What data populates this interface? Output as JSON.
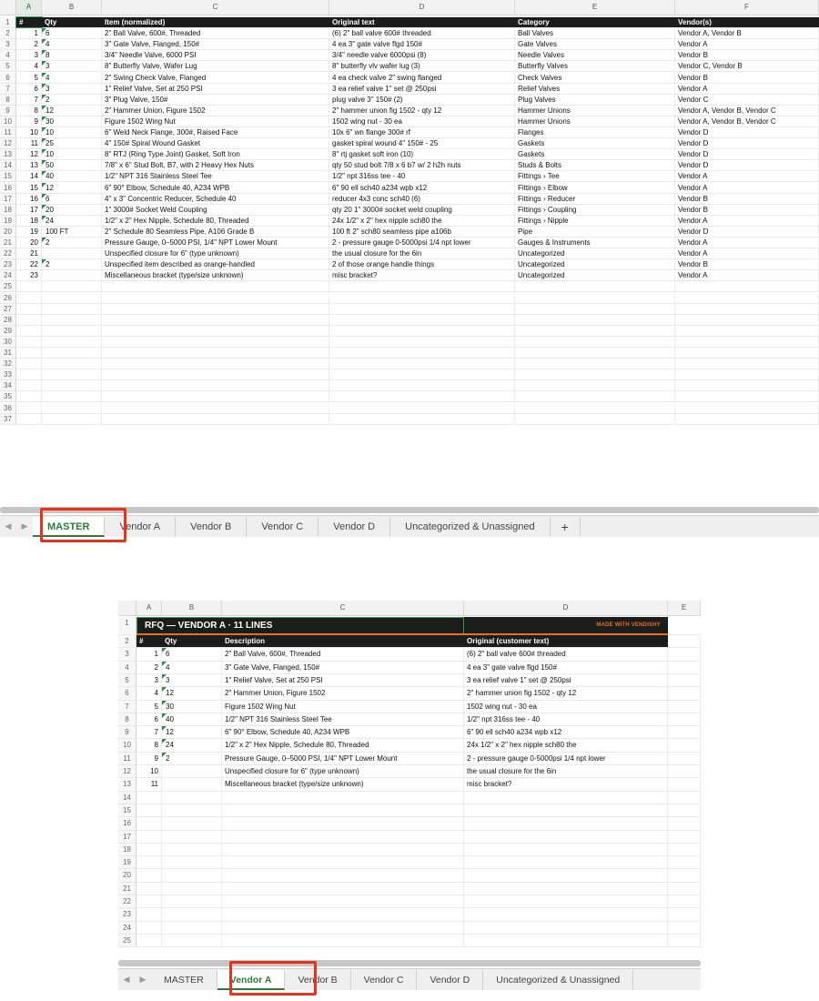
{
  "master": {
    "columns": [
      "A",
      "B",
      "C",
      "D",
      "E",
      "F"
    ],
    "headers": [
      "#",
      "Qty",
      "Item (normalized)",
      "Original text",
      "Category",
      "Vendor(s)"
    ],
    "rows": [
      [
        "1",
        "6",
        "2\" Ball Valve, 600#, Threaded",
        "(6) 2\" ball valve 600# threaded",
        "Ball Valves",
        "Vendor A, Vendor B"
      ],
      [
        "2",
        "4",
        "3\" Gate Valve, Flanged, 150#",
        "4 ea 3\" gate valve flgd 150#",
        "Gate Valves",
        "Vendor A"
      ],
      [
        "3",
        "8",
        "3/4\" Needle Valve, 6000 PSI",
        "3/4\" needle valve 6000psi (8)",
        "Needle Valves",
        "Vendor B"
      ],
      [
        "4",
        "3",
        "8\" Butterfly Valve, Wafer Lug",
        "8\" butterfly vlv wafer lug (3)",
        "Butterfly Valves",
        "Vendor C, Vendor B"
      ],
      [
        "5",
        "4",
        "2\" Swing Check Valve, Flanged",
        "4 ea check valve 2\" swing flanged",
        "Check Valves",
        "Vendor B"
      ],
      [
        "6",
        "3",
        "1\" Relief Valve, Set at 250 PSI",
        "3 ea relief valve 1\" set @ 250psi",
        "Relief Valves",
        "Vendor A"
      ],
      [
        "7",
        "2",
        "3\" Plug Valve, 150#",
        "plug valve 3\" 150# (2)",
        "Plug Valves",
        "Vendor C"
      ],
      [
        "8",
        "12",
        "2\" Hammer Union, Figure 1502",
        "2\" hammer union fig 1502 - qty 12",
        "Hammer Unions",
        "Vendor A, Vendor B, Vendor C"
      ],
      [
        "9",
        "30",
        "Figure 1502 Wing Nut",
        "1502 wing nut - 30 ea",
        "Hammer Unions",
        "Vendor A, Vendor B, Vendor C"
      ],
      [
        "10",
        "10",
        "6\" Weld Neck Flange, 300#, Raised Face",
        "10x 6\" wn flange 300# rf",
        "Flanges",
        "Vendor D"
      ],
      [
        "11",
        "25",
        "4\" 150# Spiral Wound Gasket",
        "gasket spiral wound 4\" 150# - 25",
        "Gaskets",
        "Vendor D"
      ],
      [
        "12",
        "10",
        "8\" RTJ (Ring Type Joint) Gasket, Soft Iron",
        "8\" rtj gasket soft iron (10)",
        "Gaskets",
        "Vendor D"
      ],
      [
        "13",
        "50",
        "7/8\" x 6\" Stud Bolt, B7, with 2 Heavy Hex Nuts",
        "qty 50 stud bolt 7/8 x 6 b7 w/ 2 h2h nuts",
        "Studs & Bolts",
        "Vendor D"
      ],
      [
        "14",
        "40",
        "1/2\" NPT 316 Stainless Steel Tee",
        "1/2\" npt 316ss tee - 40",
        "Fittings › Tee",
        "Vendor A"
      ],
      [
        "15",
        "12",
        "6\" 90° Elbow, Schedule 40, A234 WPB",
        "6\" 90 ell sch40 a234 wpb x12",
        "Fittings › Elbow",
        "Vendor A"
      ],
      [
        "16",
        "6",
        "4\" x 3\" Concentric Reducer, Schedule 40",
        "reducer 4x3 conc sch40 (6)",
        "Fittings › Reducer",
        "Vendor B"
      ],
      [
        "17",
        "20",
        "1\" 3000# Socket Weld Coupling",
        "qty 20 1\" 3000# socket weld coupling",
        "Fittings › Coupling",
        "Vendor B"
      ],
      [
        "18",
        "24",
        "1/2\" x 2\" Hex Nipple, Schedule 80, Threaded",
        "24x 1/2\" x 2\" hex nipple sch80 the",
        "Fittings › Nipple",
        "Vendor A"
      ],
      [
        "19",
        "100 FT",
        "2\" Schedule 80 Seamless Pipe, A106 Grade B",
        "100 ft 2\" sch80 seamless pipe a106b",
        "Pipe",
        "Vendor D"
      ],
      [
        "20",
        "2",
        "Pressure Gauge, 0–5000 PSI, 1/4\" NPT Lower Mount",
        "2 - pressure gauge 0-5000psi 1/4 npt lower",
        "Gauges & Instruments",
        "Vendor A"
      ],
      [
        "21",
        "",
        "Unspecified closure for 6\" (type unknown)",
        "the usual closure for the 6in",
        "Uncategorized",
        "Vendor A"
      ],
      [
        "22",
        "2",
        "Unspecified item described as orange-handled",
        "2 of those orange handle things",
        "Uncategorized",
        "Vendor B"
      ],
      [
        "23",
        "",
        "Miscellaneous bracket (type/size unknown)",
        "misc bracket?",
        "Uncategorized",
        "Vendor A"
      ]
    ],
    "row_numbers": [
      "1",
      "2",
      "3",
      "4",
      "5",
      "6",
      "7",
      "8",
      "9",
      "10",
      "11",
      "12",
      "13",
      "14",
      "15",
      "16",
      "17",
      "18",
      "19",
      "20",
      "21",
      "22",
      "23",
      "24",
      "25",
      "26",
      "27",
      "28",
      "29",
      "30",
      "31",
      "32",
      "33",
      "34",
      "35",
      "36",
      "37"
    ],
    "tabs": [
      "MASTER",
      "Vendor A",
      "Vendor B",
      "Vendor C",
      "Vendor D",
      "Uncategorized & Unassigned",
      "+"
    ],
    "active_tab": "MASTER"
  },
  "vendor_a": {
    "columns": [
      "A",
      "B",
      "C",
      "D",
      "E"
    ],
    "banner_title": "RFQ — VENDOR A  ·  11 LINES",
    "banner_made": "MADE WITH VENDISHY",
    "headers": [
      "#",
      "Qty",
      "Description",
      "Original (customer text)"
    ],
    "rows": [
      [
        "1",
        "6",
        "2\" Ball Valve, 600#, Threaded",
        "(6) 2\" ball valve 600# threaded"
      ],
      [
        "2",
        "4",
        "3\" Gate Valve, Flanged, 150#",
        "4 ea 3\" gate valve flgd 150#"
      ],
      [
        "3",
        "3",
        "1\" Relief Valve, Set at 250 PSI",
        "3 ea relief valve 1\" set @ 250psi"
      ],
      [
        "4",
        "12",
        "2\" Hammer Union, Figure 1502",
        "2\" hammer union fig 1502 - qty 12"
      ],
      [
        "5",
        "30",
        "Figure 1502 Wing Nut",
        "1502 wing nut - 30 ea"
      ],
      [
        "6",
        "40",
        "1/2\" NPT 316 Stainless Steel Tee",
        "1/2\" npt 316ss tee - 40"
      ],
      [
        "7",
        "12",
        "6\" 90° Elbow, Schedule 40, A234 WPB",
        "6\" 90 ell sch40 a234 wpb x12"
      ],
      [
        "8",
        "24",
        "1/2\" x 2\" Hex Nipple, Schedule 80, Threaded",
        "24x 1/2\" x 2\" hex nipple sch80 the"
      ],
      [
        "9",
        "2",
        "Pressure Gauge, 0–5000 PSI, 1/4\" NPT Lower Mount",
        "2 - pressure gauge 0-5000psi 1/4 npt lower"
      ],
      [
        "10",
        "",
        "Unspecified closure for 6\" (type unknown)",
        "the usual closure for the 6in"
      ],
      [
        "11",
        "",
        "Miscellaneous bracket (type/size unknown)",
        "misc bracket?"
      ]
    ],
    "row_numbers": [
      "1",
      "2",
      "3",
      "4",
      "5",
      "6",
      "7",
      "8",
      "9",
      "10",
      "11",
      "12",
      "13",
      "14",
      "15",
      "16",
      "17",
      "18",
      "19",
      "20",
      "21",
      "22",
      "23",
      "24",
      "25"
    ],
    "tabs": [
      "MASTER",
      "Vendor A",
      "Vendor B",
      "Vendor C",
      "Vendor D",
      "Uncategorized & Unassigned"
    ],
    "active_tab": "Vendor A"
  },
  "colors": {
    "header_bg": "#1c1c1c",
    "accent_green": "#2b7a3c",
    "highlight_red": "#e8331c",
    "brand_orange": "#e8711c"
  }
}
